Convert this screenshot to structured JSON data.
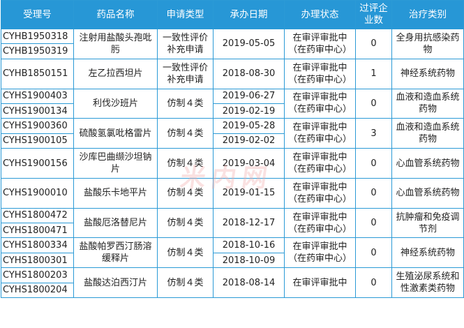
{
  "table": {
    "headers": [
      "受理号",
      "药品名称",
      "申请类型",
      "承办日期",
      "办理状态",
      "过评企业数",
      "治疗类别"
    ],
    "rows": [
      {
        "codes": [
          "CYHB1950318",
          "CYHB1950319"
        ],
        "drug": "注射用盐酸头孢吡肟",
        "type": "一致性评价补充申请",
        "dates": [
          "2019-05-05"
        ],
        "status": "在审评审批中（在药审中心）",
        "count": "0",
        "category": "全身用抗感染药物"
      },
      {
        "codes": [
          "CYHB1850151"
        ],
        "drug": "左乙拉西坦片",
        "type": "一致性评价补充申请",
        "dates": [
          "2018-08-30"
        ],
        "status": "在审评审批中（在药审中心）",
        "count": "1",
        "category": "神经系统药物"
      },
      {
        "codes": [
          "CYHS1900403",
          "CYHS1900134"
        ],
        "drug": "利伐沙班片",
        "type": "仿制４类",
        "dates": [
          "2019-06-27",
          "2019-02-19"
        ],
        "status": "在审评审批中（在药审中心）",
        "count": "0",
        "category": "血液和造血系统药物"
      },
      {
        "codes": [
          "CYHS1900360",
          "CYHS1900105"
        ],
        "drug": "硫酸氢氯吡格雷片",
        "type": "仿制４类",
        "dates": [
          "2019-05-28",
          "2019-02-02"
        ],
        "status": "在审评审批中（在药审中心）",
        "count": "3",
        "category": "血液和造血系统药物"
      },
      {
        "codes": [
          "CYHS1900156"
        ],
        "drug": "沙库巴曲缬沙坦钠片",
        "type": "仿制４类",
        "dates": [
          "2019-03-04"
        ],
        "status": "在审评审批中（在药审中心）",
        "count": "0",
        "category": "心血管系统药物"
      },
      {
        "codes": [
          "CYHS1900010"
        ],
        "drug": "盐酸乐卡地平片",
        "type": "仿制４类",
        "dates": [
          "2019-01-15"
        ],
        "status": "在审评审批中（在药审中心）",
        "count": "0",
        "category": "心血管系统药物"
      },
      {
        "codes": [
          "CYHS1800472",
          "CYHS1800471"
        ],
        "drug": "盐酸厄洛替尼片",
        "type": "仿制４类",
        "dates": [
          "2018-12-17"
        ],
        "status": "在审评审批中（在药审中心）",
        "count": "0",
        "category": "抗肿瘤和免疫调节剂"
      },
      {
        "codes": [
          "CYHS1800334",
          "CYHS1800301"
        ],
        "drug": "盐酸帕罗西汀肠溶缓释片",
        "type": "仿制４类",
        "dates": [
          "2018-10-16",
          "2018-10-09"
        ],
        "status": "在审评审批中（在药审中心）",
        "count": "0",
        "category": "神经系统药物"
      },
      {
        "codes": [
          "CYHS1800203",
          "CYHS1800204"
        ],
        "drug": "盐酸达泊西汀片",
        "type": "仿制４类",
        "dates": [
          "2018-08-14"
        ],
        "status": "在审评审批中",
        "count": "0",
        "category": "生殖泌尿系统和性激素类药物"
      }
    ]
  },
  "watermark": "米内网"
}
